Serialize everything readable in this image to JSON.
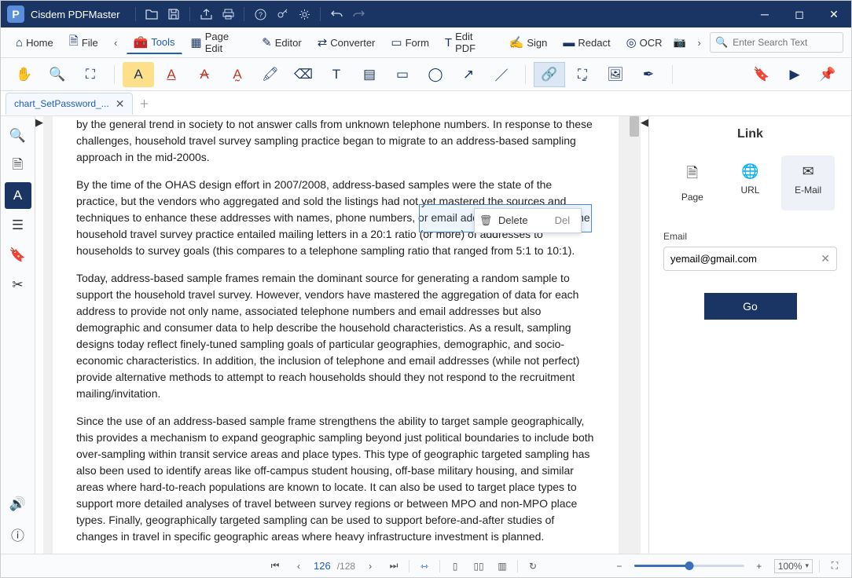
{
  "titlebar": {
    "app_name": "Cisdem PDFMaster"
  },
  "menubar": {
    "home": "Home",
    "file": "File",
    "tools": "Tools",
    "page_edit": "Page Edit",
    "editor": "Editor",
    "converter": "Converter",
    "form": "Form",
    "edit_pdf": "Edit PDF",
    "sign": "Sign",
    "redact": "Redact",
    "ocr": "OCR",
    "search_placeholder": "Enter Search Text"
  },
  "tabs": {
    "file1": "chart_SetPassword_..."
  },
  "context_menu": {
    "delete_label": "Delete",
    "delete_shortcut": "Del"
  },
  "document": {
    "p1": "by the general trend in society to not answer calls from unknown telephone numbers. In response to these challenges, household travel survey sampling practice began to migrate to an address-based sampling approach in the mid-2000s.",
    "p2": "By the time of the OHAS design effort in 2007/2008, address-based samples were the state of the practice, but the vendors who aggregated and sold the listings had not yet mastered the sources and techniques to enhance these addresses with names, phone numbers, or email addresses. As a result, the household travel survey practice entailed mailing letters in a 20:1 ratio (or more) of addresses to households to survey goals (this compares to a telephone sampling ratio that ranged from 5:1 to 10:1).",
    "p3": "Today, address-based sample frames remain the dominant source for generating a random sample to support the household travel survey. However, vendors have mastered the aggregation of data for each address to provide not only name, associated telephone numbers and email addresses but also demographic and consumer data to help describe the household characteristics. As a result, sampling designs today reflect finely-tuned sampling goals of particular geographies, demographic, and socio-economic characteristics. In addition, the inclusion of telephone and email addresses (while not perfect) provide alternative methods to attempt to reach households should they not respond to the recruitment mailing/invitation.",
    "p4": "Since the use of an address-based sample frame strengthens the ability to target sample geographically, this provides a mechanism to expand geographic sampling beyond just political boundaries to include both over-sampling within transit service areas and place types. This type of geographic targeted sampling has also been used to identify areas like off-campus student housing, off-base military housing, and similar areas where hard-to-reach populations are known to locate. It can also be used to target place types to support more detailed analyses of travel between survey regions or between MPO and non-MPO place types. Finally, geographically targeted sampling can be used to support before-and-after studies of changes in travel in specific geographic areas where heavy infrastructure investment is planned."
  },
  "linkpanel": {
    "title": "Link",
    "tab_page": "Page",
    "tab_url": "URL",
    "tab_email": "E-Mail",
    "email_label": "Email",
    "email_value": "yemail@gmail.com",
    "go": "Go"
  },
  "statusbar": {
    "page_current": "126",
    "page_total": "/128",
    "zoom": "100%"
  }
}
